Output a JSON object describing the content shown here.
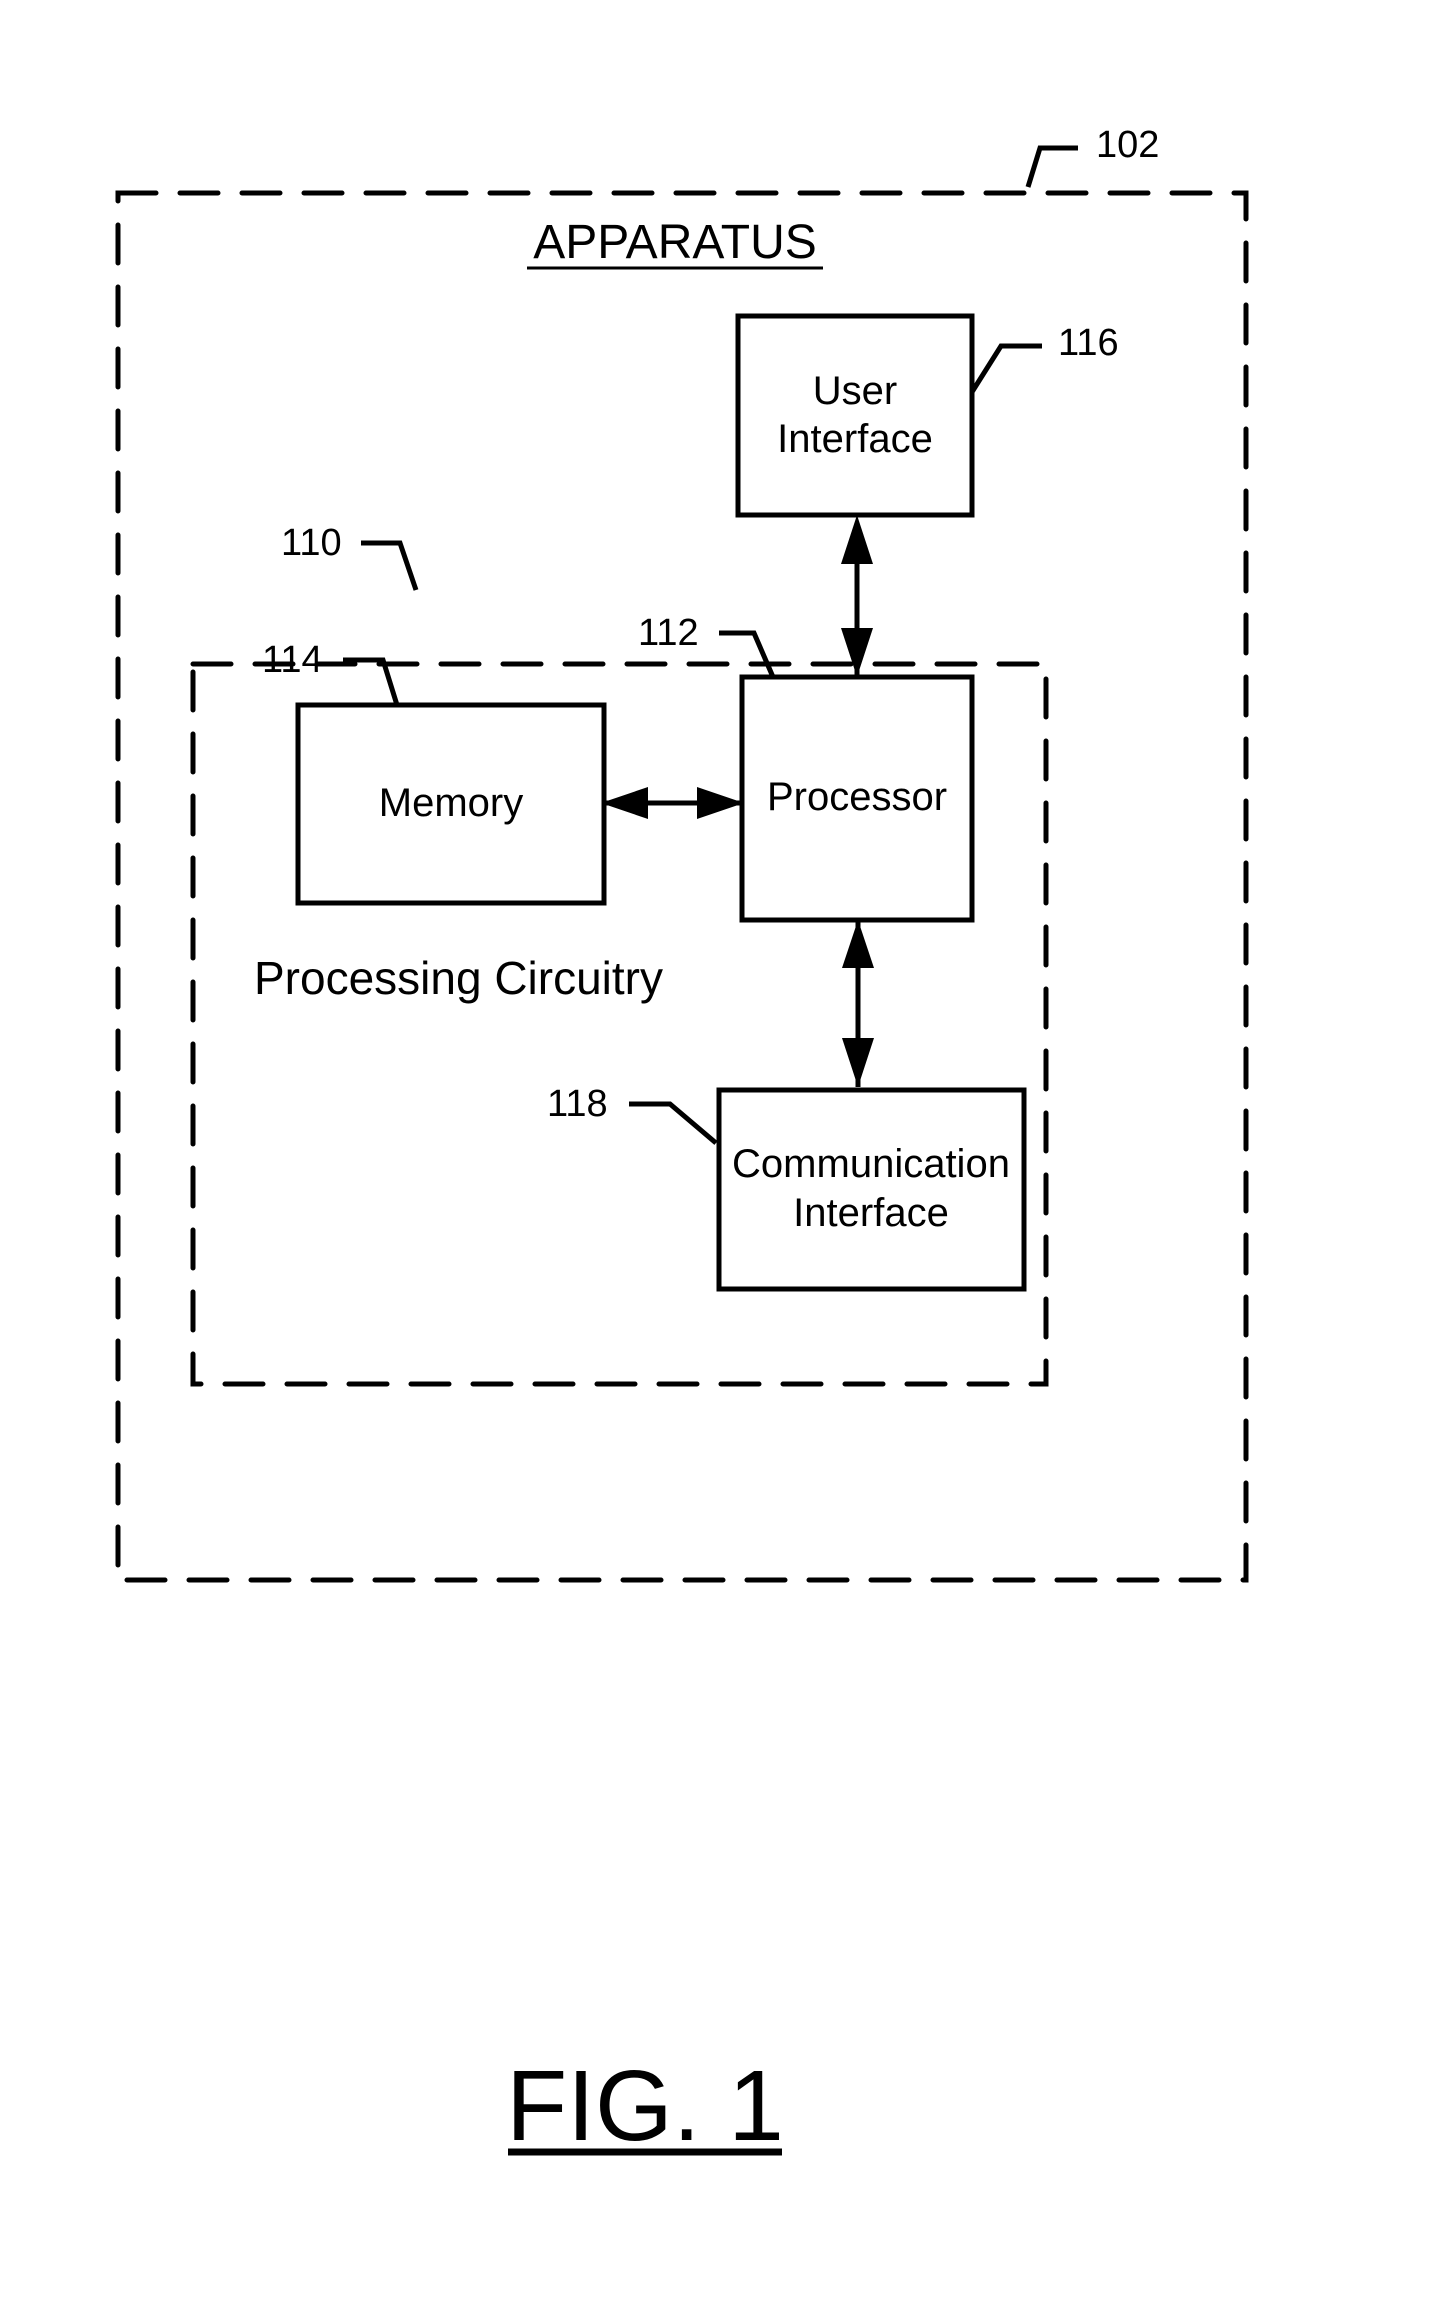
{
  "figure": {
    "title": "FIG. 1",
    "apparatus": {
      "title": "APPARATUS",
      "ref": "102"
    },
    "processing_circuitry": {
      "title": "Processing Circuitry",
      "ref": "110"
    },
    "blocks": {
      "user_interface": {
        "lines": [
          "User",
          "Interface"
        ],
        "ref": "116"
      },
      "processor": {
        "lines": [
          "Processor"
        ],
        "ref": "112"
      },
      "memory": {
        "lines": [
          "Memory"
        ],
        "ref": "114"
      },
      "communication_interface": {
        "lines": [
          "Communication",
          "Interface"
        ],
        "ref": "118"
      }
    },
    "connections": [
      {
        "from": "user_interface",
        "to": "processor",
        "type": "bidirectional"
      },
      {
        "from": "memory",
        "to": "processor",
        "type": "bidirectional"
      },
      {
        "from": "processor",
        "to": "communication_interface",
        "type": "bidirectional"
      }
    ]
  }
}
